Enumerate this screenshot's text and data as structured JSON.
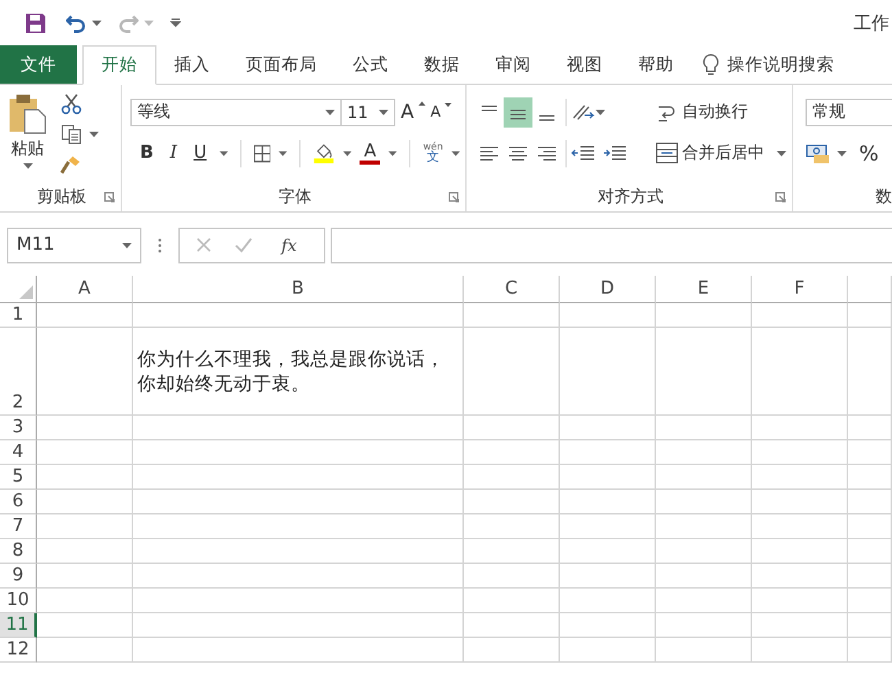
{
  "title_bar": {
    "document_title": "工作",
    "redo_enabled": false
  },
  "tabs": [
    {
      "label": "文件",
      "kind": "file",
      "selected": false
    },
    {
      "label": "开始",
      "kind": "tab",
      "selected": true
    },
    {
      "label": "插入",
      "kind": "tab",
      "selected": false
    },
    {
      "label": "页面布局",
      "kind": "tab",
      "selected": false
    },
    {
      "label": "公式",
      "kind": "tab",
      "selected": false
    },
    {
      "label": "数据",
      "kind": "tab",
      "selected": false
    },
    {
      "label": "审阅",
      "kind": "tab",
      "selected": false
    },
    {
      "label": "视图",
      "kind": "tab",
      "selected": false
    },
    {
      "label": "帮助",
      "kind": "tab",
      "selected": false
    }
  ],
  "tell_me": "操作说明搜索",
  "ribbon": {
    "clipboard": {
      "paste": "粘贴",
      "label": "剪贴板"
    },
    "font": {
      "font_name": "等线",
      "font_size": "11",
      "grow_glyph": "A",
      "shrink_glyph": "A",
      "bold": "B",
      "italic": "I",
      "underline": "U",
      "font_color_glyph": "A",
      "phonetic_top": "wén",
      "phonetic_bottom": "文",
      "label": "字体"
    },
    "alignment": {
      "vertical_align": [
        {
          "kind": "top",
          "selected": false
        },
        {
          "kind": "middle",
          "selected": true
        },
        {
          "kind": "bottom",
          "selected": false
        }
      ],
      "horizontal_align": [
        {
          "kind": "left",
          "selected": false
        },
        {
          "kind": "center",
          "selected": false
        },
        {
          "kind": "right",
          "selected": false
        }
      ],
      "wrap_text": "自动换行",
      "merge_center": "合并后居中",
      "label": "对齐方式"
    },
    "number": {
      "format": "常规",
      "percent": "%",
      "label": "数"
    }
  },
  "formula_bar": {
    "name_box": "M11",
    "function_glyph": "fx"
  },
  "sheet": {
    "columns": [
      {
        "label": "A",
        "selected": false
      },
      {
        "label": "B",
        "selected": false
      },
      {
        "label": "C",
        "selected": false
      },
      {
        "label": "D",
        "selected": false
      },
      {
        "label": "E",
        "selected": false
      },
      {
        "label": "F",
        "selected": false
      }
    ],
    "rows": [
      {
        "header": "1",
        "selected": false,
        "cells": []
      },
      {
        "header": "2",
        "selected": false,
        "cells": [
          {
            "kind": "empty"
          },
          {
            "kind": "text",
            "text": "你为什么不理我，我总是跟你说话，你却始终无动于衷。"
          }
        ]
      },
      {
        "header": "3",
        "selected": false,
        "cells": []
      },
      {
        "header": "4",
        "selected": false,
        "cells": []
      },
      {
        "header": "5",
        "selected": false,
        "cells": []
      },
      {
        "header": "6",
        "selected": false,
        "cells": []
      },
      {
        "header": "7",
        "selected": false,
        "cells": []
      },
      {
        "header": "8",
        "selected": false,
        "cells": []
      },
      {
        "header": "9",
        "selected": false,
        "cells": []
      },
      {
        "header": "10",
        "selected": false,
        "cells": []
      },
      {
        "header": "11",
        "selected": true,
        "cells": []
      },
      {
        "header": "12",
        "selected": false,
        "cells": []
      }
    ]
  }
}
